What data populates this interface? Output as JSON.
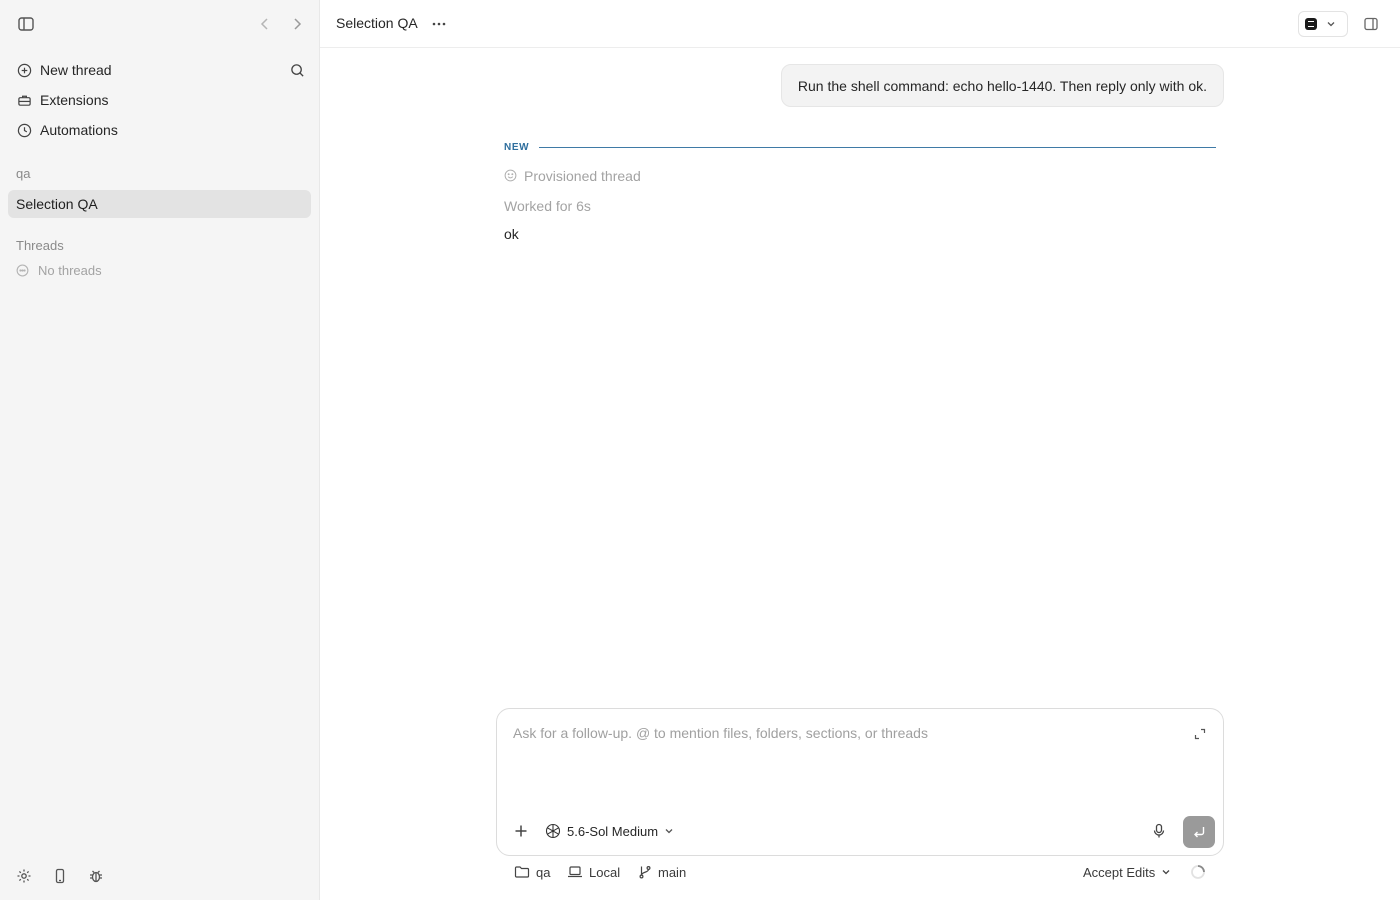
{
  "sidebar": {
    "new_thread": "New thread",
    "extensions": "Extensions",
    "automations": "Automations",
    "project_section": "qa",
    "selected_item": "Selection QA",
    "threads_section": "Threads",
    "no_threads": "No threads"
  },
  "header": {
    "title": "Selection QA"
  },
  "conversation": {
    "user_message": "Run the shell command: echo hello-1440. Then reply only with ok.",
    "new_label": "NEW",
    "provisioned": "Provisioned thread",
    "worked_for": "Worked for 6s",
    "reply": "ok"
  },
  "composer": {
    "placeholder": "Ask for a follow-up. @ to mention files, folders, sections, or threads",
    "model": "5.6-Sol Medium"
  },
  "footer": {
    "folder": "qa",
    "environment": "Local",
    "branch": "main",
    "edit_mode": "Accept Edits"
  },
  "colors": {
    "sidebar_bg": "#f5f5f5",
    "selected_bg": "#e3e3e3",
    "accent_divider": "#3f7aa6",
    "send_button": "#9a9a9a"
  }
}
